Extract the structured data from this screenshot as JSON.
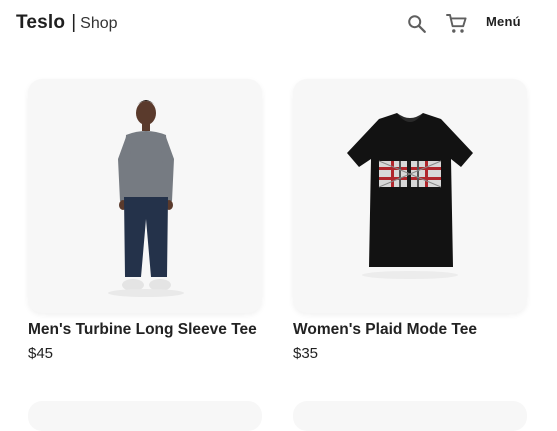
{
  "header": {
    "brand": "Teslo",
    "separator": "|",
    "subtitle": "Shop",
    "menu_label": "Menú",
    "icons": [
      "search-icon",
      "cart-icon"
    ]
  },
  "products": [
    {
      "title": "Men's Turbine Long Sleeve Tee",
      "price": "$45",
      "image": "man-grey-long-sleeve-photo"
    },
    {
      "title": "Women's Plaid Mode Tee",
      "price": "$35",
      "image": "black-tee-plaid-graphic-photo"
    }
  ],
  "colors": {
    "card_background": "#f7f7f7",
    "text": "#1f1f1f"
  }
}
